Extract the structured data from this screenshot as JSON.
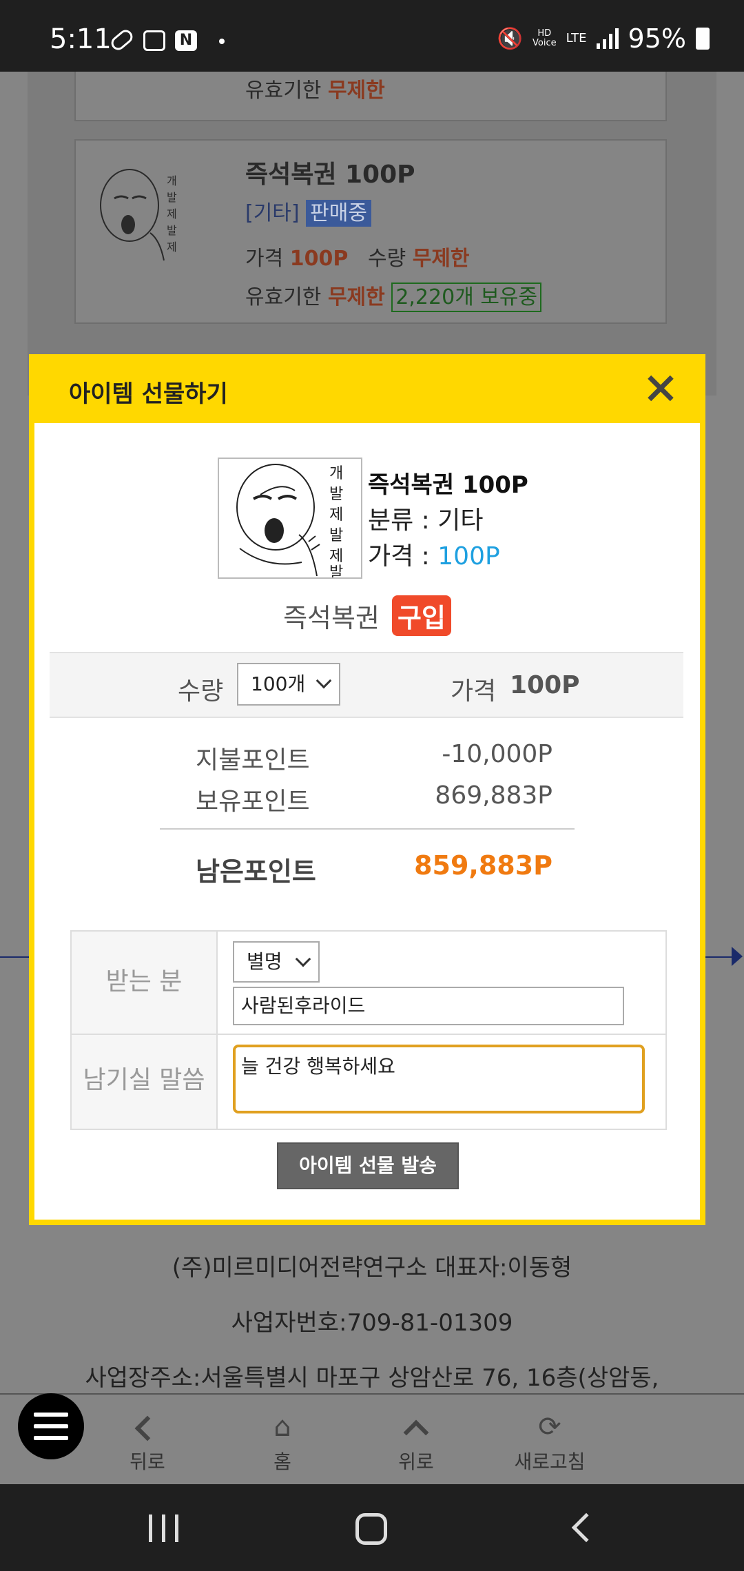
{
  "status_bar": {
    "time": "5:11",
    "hd_label": "HD",
    "voice_label": "Voice",
    "lte_label": "LTE",
    "battery": "95%"
  },
  "background_page": {
    "card1": {
      "expiry_label": "유효기한",
      "expiry_value": "무제한"
    },
    "card2": {
      "title": "즉석복권 100P",
      "category": "[기타]",
      "status": "판매중",
      "price_label": "가격",
      "price_value": "100P",
      "qty_label": "수량",
      "qty_value": "무제한",
      "expiry_label": "유효기한",
      "expiry_value": "무제한",
      "owned": "2,220개 보유중"
    },
    "footer": {
      "line1": "(주)미르미디어전략연구소 대표자:이동형",
      "line2": "사업자번호:709-81-01309",
      "line3": "사업장주소:서울특별시 마포구 상암산로 76, 16층(상암동,"
    }
  },
  "modal": {
    "title": "아이템 선물하기",
    "item": {
      "image_text": "개발제발제발",
      "name": "즉석복권 100P",
      "category_line": "분류 : 기타",
      "price_label": "가격 : ",
      "price_value": "100P"
    },
    "buy_line": {
      "item": "즉석복권",
      "badge": "구입"
    },
    "quantity": {
      "label": "수량",
      "selected": "100개",
      "price_label": "가격",
      "price_value": "100P"
    },
    "points": {
      "pay_label": "지불포인트",
      "pay_value": "-10,000P",
      "own_label": "보유포인트",
      "own_value": "869,883P",
      "remain_label": "남은포인트",
      "remain_value": "859,883P"
    },
    "form": {
      "recipient_label": "받는 분",
      "recipient_type": "별명",
      "recipient_value": "사람된후라이드",
      "message_label": "남기실 말씀",
      "message_value": "늘 건강 행복하세요"
    },
    "send_button": "아이템 선물 발송"
  },
  "bottom_nav": {
    "items": [
      {
        "label": "뒤로"
      },
      {
        "label": "홈"
      },
      {
        "label": "위로"
      },
      {
        "label": "새로고침"
      }
    ]
  }
}
